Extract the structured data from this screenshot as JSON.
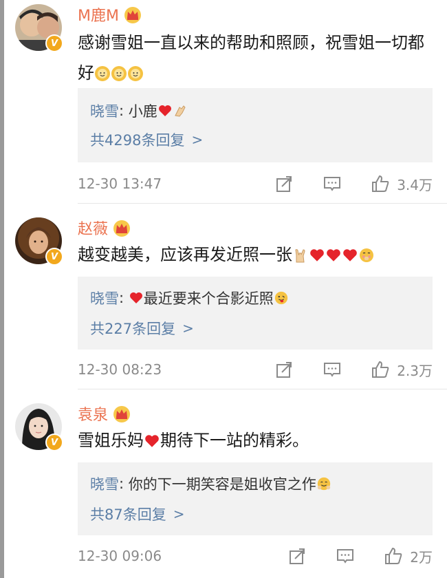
{
  "comments": [
    {
      "username": "M鹿M",
      "text": "感谢雪姐一直以来的帮助和照顾，祝雪姐一切都好",
      "reply": {
        "author": "晓雪",
        "text": "小鹿"
      },
      "reply_count": "共4298条回复",
      "time": "12-30 13:47",
      "likes": "3.4万"
    },
    {
      "username": "赵薇",
      "text": "越变越美，应该再发近照一张",
      "reply": {
        "author": "晓雪",
        "text": "最近要来个合影近照"
      },
      "reply_count": "共227条回复",
      "time": "12-30 08:23",
      "likes": "2.3万"
    },
    {
      "username": "袁泉",
      "text": "雪姐乐妈",
      "text_after": "期待下一站的精彩。",
      "reply": {
        "author": "晓雪",
        "text": "你的下一期笑容是姐收官之作"
      },
      "reply_count": "共87条回复",
      "time": "12-30 09:06",
      "likes": "2万"
    }
  ],
  "icons": [
    "verified-icon",
    "crown-icon",
    "repost-icon",
    "comment-icon",
    "like-icon",
    "heart-emoji",
    "sun-smile-emoji",
    "rock-hand-emoji",
    "clap-emoji"
  ],
  "colors": {
    "username": "#eb7350",
    "link": "#5b7ea6",
    "reply_bg": "#f2f2f2",
    "heart": "#e5242b"
  }
}
